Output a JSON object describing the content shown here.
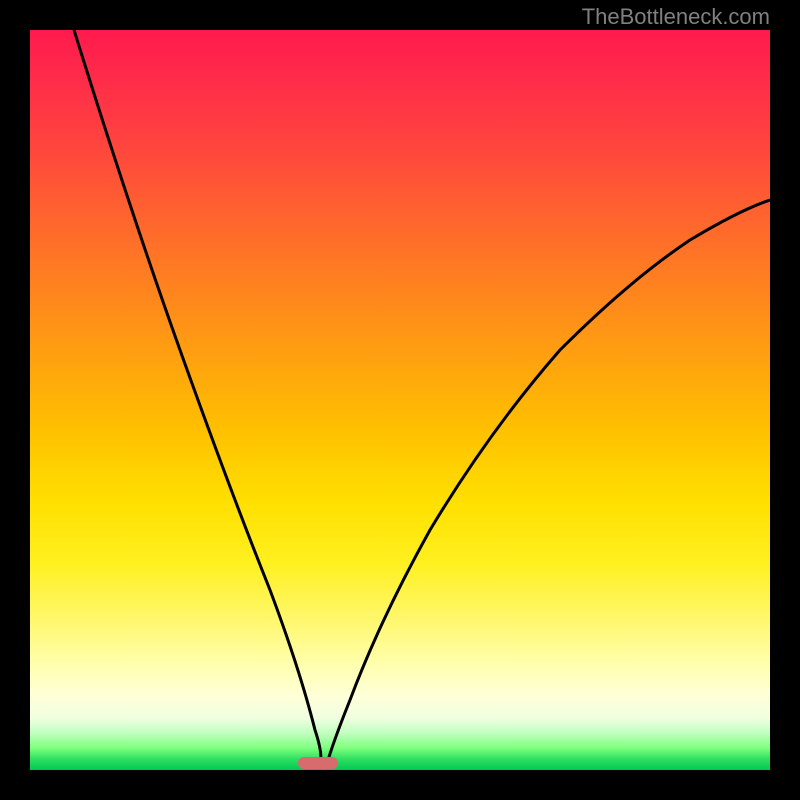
{
  "watermark": "TheBottleneck.com",
  "chart_data": {
    "type": "line",
    "title": "",
    "xlabel": "",
    "ylabel": "",
    "xlim": [
      0,
      100
    ],
    "ylim": [
      0,
      100
    ],
    "series": [
      {
        "name": "curve-left",
        "x": [
          6,
          10,
          14,
          18,
          22,
          26,
          30,
          33,
          36,
          37.5,
          38.5,
          39
        ],
        "y": [
          100,
          86,
          72,
          58,
          45,
          33,
          22,
          13,
          6,
          2,
          0.5,
          0
        ]
      },
      {
        "name": "curve-right",
        "x": [
          40,
          41,
          43,
          46,
          50,
          55,
          60,
          66,
          72,
          78,
          85,
          92,
          100
        ],
        "y": [
          0,
          1,
          4,
          9,
          16,
          24,
          32,
          40,
          48,
          55,
          62,
          68,
          74
        ]
      }
    ],
    "marker": {
      "x": 39,
      "y": 0,
      "color": "#d86b6b"
    },
    "background_gradient": {
      "top": "#ff1a4d",
      "middle": "#ffd000",
      "bottom": "#00c855"
    }
  }
}
